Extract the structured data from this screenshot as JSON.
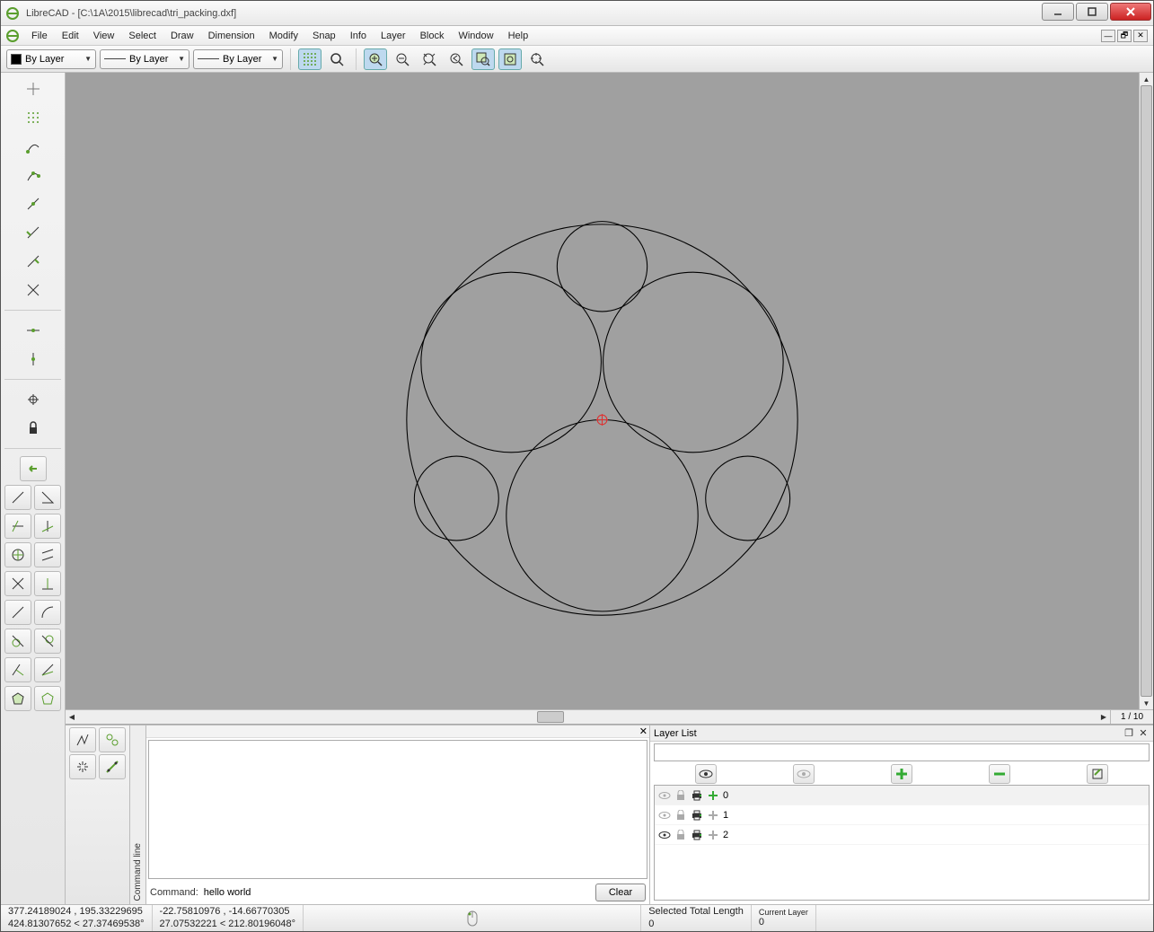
{
  "title": "LibreCAD - [C:\\1A\\2015\\librecad\\tri_packing.dxf]",
  "menus": [
    "File",
    "Edit",
    "View",
    "Select",
    "Draw",
    "Dimension",
    "Modify",
    "Snap",
    "Info",
    "Layer",
    "Block",
    "Window",
    "Help"
  ],
  "combos": {
    "color": "By Layer",
    "width": "By Layer",
    "linetype": "By Layer"
  },
  "canvas": {
    "page_indicator": "1 / 10"
  },
  "command": {
    "tab_label": "Command line",
    "prompt": "Command:",
    "input_value": "hello world",
    "clear_btn": "Clear"
  },
  "layers": {
    "title": "Layer List",
    "items": [
      {
        "name": "0",
        "visible": false
      },
      {
        "name": "1",
        "visible": false
      },
      {
        "name": "2",
        "visible": true
      }
    ]
  },
  "status": {
    "abs1": "377.24189024 , 195.33229695",
    "abs2": "424.81307652 < 27.37469538°",
    "rel1": "-22.75810976 , -14.66770305",
    "rel2": "27.07532221 < 212.80196048°",
    "selected_label": "Selected Total Length",
    "selected_value": "0",
    "current_layer_label": "Current Layer",
    "current_layer_value": "0"
  }
}
